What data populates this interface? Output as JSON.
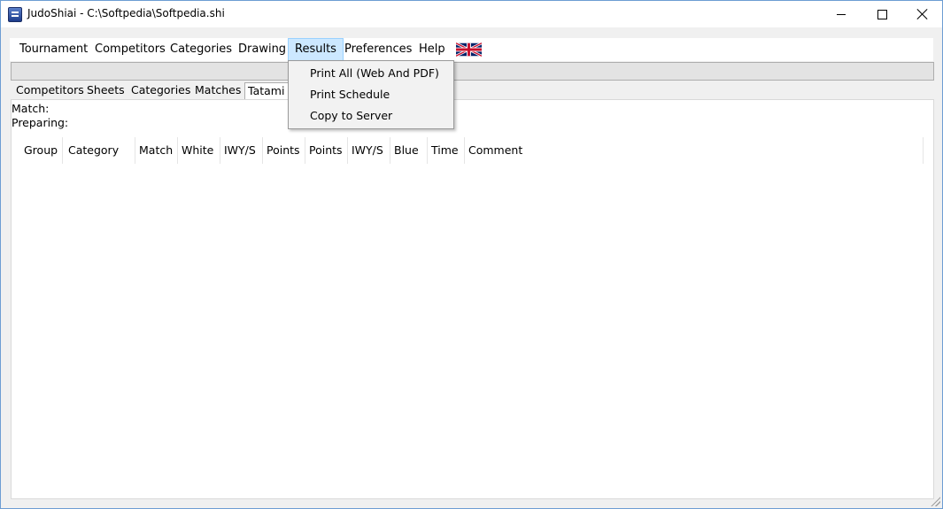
{
  "window": {
    "title": "JudoShiai - C:\\Softpedia\\Softpedia.shi"
  },
  "menubar": {
    "items": [
      {
        "label": "Tournament"
      },
      {
        "label": "Competitors"
      },
      {
        "label": "Categories"
      },
      {
        "label": "Drawing"
      },
      {
        "label": "Results"
      },
      {
        "label": "Preferences"
      },
      {
        "label": "Help"
      }
    ],
    "active_item": "Results",
    "language_flag": "uk-flag-icon"
  },
  "tabs": [
    {
      "label": "Competitors"
    },
    {
      "label": "Sheets"
    },
    {
      "label": "Categories"
    },
    {
      "label": "Matches"
    },
    {
      "label": "Tatami 1"
    }
  ],
  "selected_tab": "Tatami 1",
  "panel": {
    "match_label": "Match:",
    "preparing_label": "Preparing:"
  },
  "table": {
    "columns": [
      "Group",
      "Category",
      "Match",
      "White",
      "IWY/S",
      "Points",
      "Points",
      "IWY/S",
      "Blue",
      "Time",
      "Comment"
    ]
  },
  "results_menu": {
    "items": [
      {
        "label": "Print All (Web And PDF)"
      },
      {
        "label": "Print Schedule"
      },
      {
        "label": "Copy to Server"
      }
    ]
  },
  "colors": {
    "active_menu_bg": "#cce8ff",
    "window_border": "#6d9dd3"
  }
}
